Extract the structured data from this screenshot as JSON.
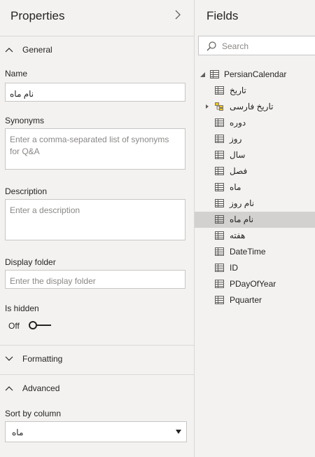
{
  "properties": {
    "title": "Properties",
    "general_label": "General",
    "name_label": "Name",
    "name_value": "نام ماه",
    "synonyms_label": "Synonyms",
    "synonyms_placeholder": "Enter a comma-separated list of synonyms for Q&A",
    "description_label": "Description",
    "description_placeholder": "Enter a description",
    "display_folder_label": "Display folder",
    "display_folder_placeholder": "Enter the display folder",
    "is_hidden_label": "Is hidden",
    "toggle_state": "Off",
    "formatting_label": "Formatting",
    "advanced_label": "Advanced",
    "sort_by_label": "Sort by column",
    "sort_by_value": "ماه"
  },
  "fields": {
    "title": "Fields",
    "search_placeholder": "Search",
    "table_name": "PersianCalendar",
    "items": [
      {
        "label": "تاریخ",
        "icon": "table-column-icon",
        "selected": false,
        "expandable": false
      },
      {
        "label": "تاریخ فارسی",
        "icon": "hierarchy-icon",
        "selected": false,
        "expandable": true
      },
      {
        "label": "دوره",
        "icon": "table-column-icon",
        "selected": false,
        "expandable": false
      },
      {
        "label": "روز",
        "icon": "table-column-icon",
        "selected": false,
        "expandable": false
      },
      {
        "label": "سال",
        "icon": "table-column-icon",
        "selected": false,
        "expandable": false
      },
      {
        "label": "فصل",
        "icon": "table-column-icon",
        "selected": false,
        "expandable": false
      },
      {
        "label": "ماه",
        "icon": "table-column-icon",
        "selected": false,
        "expandable": false
      },
      {
        "label": "نام روز",
        "icon": "table-column-icon",
        "selected": false,
        "expandable": false
      },
      {
        "label": "نام ماه",
        "icon": "table-column-icon",
        "selected": true,
        "expandable": false
      },
      {
        "label": "هفته",
        "icon": "table-column-icon",
        "selected": false,
        "expandable": false
      },
      {
        "label": "DateTime",
        "icon": "table-column-icon",
        "selected": false,
        "expandable": false
      },
      {
        "label": "ID",
        "icon": "table-column-icon",
        "selected": false,
        "expandable": false
      },
      {
        "label": "PDayOfYear",
        "icon": "table-column-icon",
        "selected": false,
        "expandable": false
      },
      {
        "label": "Pquarter",
        "icon": "table-column-icon",
        "selected": false,
        "expandable": false
      }
    ]
  },
  "colors": {
    "pane_bg": "#f3f2f1",
    "selected_row": "#d3d1cf",
    "border": "#c8c6c4"
  }
}
